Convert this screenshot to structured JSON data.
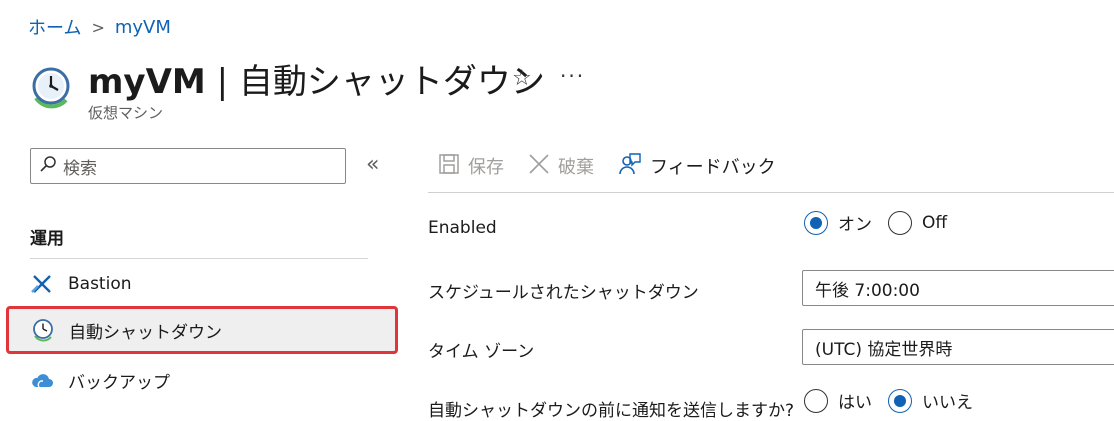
{
  "breadcrumb": {
    "home": "ホーム",
    "separator": ">",
    "current": "myVM"
  },
  "header": {
    "resource_name": "myVM",
    "divider": "|",
    "page_name": "自動シャットダウン",
    "star": "☆",
    "more": "···",
    "subtitle": "仮想マシン"
  },
  "nav": {
    "search_placeholder": "検索",
    "collapse": "«",
    "section": "運用",
    "items": [
      {
        "label": "Bastion",
        "icon": "bastion-icon"
      },
      {
        "label": "自動シャットダウン",
        "icon": "clock-icon",
        "selected": true
      },
      {
        "label": "バックアップ",
        "icon": "cloud-backup-icon"
      }
    ]
  },
  "toolbar": {
    "save": "保存",
    "discard": "破棄",
    "feedback": "フィードバック"
  },
  "form": {
    "enabled": {
      "label": "Enabled",
      "on": "オン",
      "off": "Off",
      "value": "on"
    },
    "schedule": {
      "label": "スケジュールされたシャットダウン",
      "value": "午後 7:00:00"
    },
    "timezone": {
      "label": "タイム ゾーン",
      "value": "(UTC) 協定世界時"
    },
    "notify": {
      "label": "自動シャットダウンの前に通知を送信しますか?",
      "yes": "はい",
      "no": "いいえ",
      "value": "no"
    }
  },
  "colors": {
    "accent": "#0f62b4",
    "selection_border": "#e0363b"
  }
}
